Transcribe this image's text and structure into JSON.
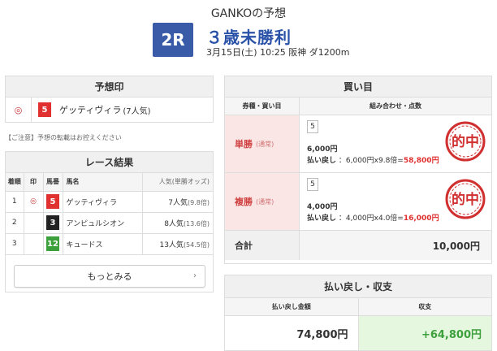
{
  "header": {
    "predictor": "GANKOの予想",
    "race_no": "2R",
    "race_name": "３歳未勝利",
    "race_info": "3月15日(土) 10:25 阪神 ダ1200m"
  },
  "yoso": {
    "title": "予想印",
    "mark": "◎",
    "num": "5",
    "horse": "ゲッティヴィラ",
    "pop": "(7人気)"
  },
  "notice": "【ご注意】予想の転載はお控えください",
  "results": {
    "title": "レース結果",
    "headers": [
      "着順",
      "印",
      "馬番",
      "馬名",
      "人気(単勝オッズ)"
    ],
    "rows": [
      {
        "rank": "1",
        "mark": "◎",
        "num": "5",
        "horse": "ゲッティヴィラ",
        "pop": "7人気",
        "odds": "(9.8倍)"
      },
      {
        "rank": "2",
        "mark": "",
        "num": "3",
        "horse": "アンピュルシオン",
        "pop": "8人気",
        "odds": "(13.6倍)"
      },
      {
        "rank": "3",
        "mark": "",
        "num": "12",
        "horse": "キュードス",
        "pop": "13人気",
        "odds": "(54.5倍)"
      }
    ],
    "more": "もっとみる"
  },
  "buy": {
    "title": "買い目",
    "col_type": "券種・買い目",
    "col_combo": "組み合わせ・点数",
    "bets": [
      {
        "type": "単勝",
        "sub": "(通常)",
        "num": "5",
        "amount": "6,000円",
        "pay_label": "払い戻し",
        "pay_calc": "：6,000円x9.8倍=",
        "pay_result": "58,800円",
        "stamp": "的中"
      },
      {
        "type": "複勝",
        "sub": "(通常)",
        "num": "5",
        "amount": "4,000円",
        "pay_label": "払い戻し",
        "pay_calc": "：4,000円x4.0倍=",
        "pay_result": "16,000円",
        "stamp": "的中"
      }
    ],
    "total_label": "合計",
    "total_value": "10,000円"
  },
  "payout": {
    "title": "払い戻し・収支",
    "col_return": "払い戻し金額",
    "col_balance": "収支",
    "return_value": "74,800円",
    "balance_value": "+64,800円"
  },
  "colors": {
    "accent_blue": "#3a5ba8",
    "red": "#e03030",
    "green": "#3ca13c"
  }
}
